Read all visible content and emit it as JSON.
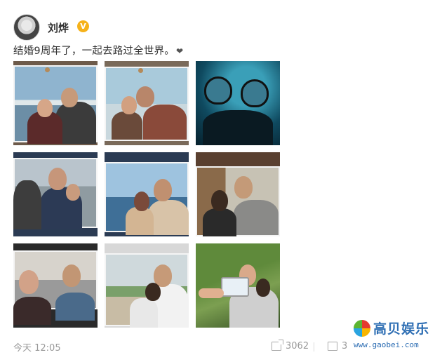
{
  "post": {
    "author": "刘烨",
    "verified_badge": "V",
    "text": "结婚9周年了，一起去路过全世界。",
    "heart": "❤",
    "time": "今天 12:05",
    "repost_count": "3062",
    "comment_count": "3"
  },
  "photos": [
    {
      "name": "photo-1"
    },
    {
      "name": "photo-2"
    },
    {
      "name": "photo-3"
    },
    {
      "name": "photo-4"
    },
    {
      "name": "photo-5"
    },
    {
      "name": "photo-6"
    },
    {
      "name": "photo-7"
    },
    {
      "name": "photo-8"
    },
    {
      "name": "photo-9"
    }
  ],
  "watermark": {
    "title": "高贝娱乐",
    "url": "www.gaobei.com"
  }
}
